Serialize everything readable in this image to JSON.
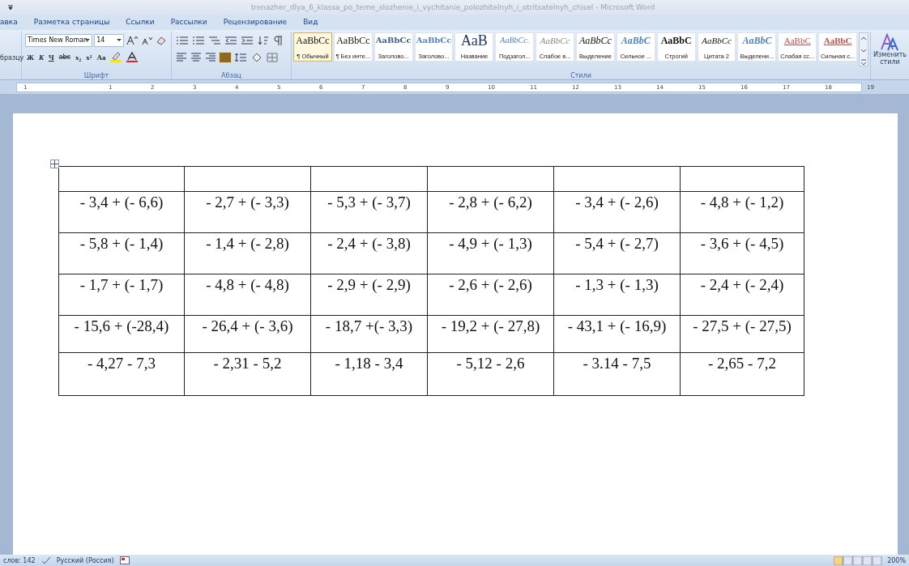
{
  "window": {
    "title": "trenazher_dlya_6_klassa_po_teme_slozhenie_i_vychitanie_polozhitelnyh_i_otritsatelnyh_chisel - Microsoft Word"
  },
  "tabs": [
    {
      "label": "авка",
      "selected": false
    },
    {
      "label": "Разметка страницы",
      "selected": false
    },
    {
      "label": "Ссылки",
      "selected": false
    },
    {
      "label": "Рассылки",
      "selected": false
    },
    {
      "label": "Рецензирование",
      "selected": false
    },
    {
      "label": "Вид",
      "selected": false
    }
  ],
  "ribbon": {
    "clipboard": {
      "label": "бразцу"
    },
    "font": {
      "name": "Times New Roman",
      "size": "14",
      "format_buttons": [
        "Ж",
        "К",
        "Ч",
        "abc",
        "x₂",
        "x²",
        "Aa"
      ],
      "group_label": "Шрифт"
    },
    "paragraph": {
      "group_label": "Абзац"
    },
    "styles": {
      "group_label": "Стили",
      "items": [
        {
          "preview": "AaBbCc",
          "label": "¶ Обычный",
          "kind": "normal",
          "selected": true
        },
        {
          "preview": "AaBbCc",
          "label": "¶ Без инте...",
          "kind": "normal",
          "selected": false
        },
        {
          "preview": "AaBbCc",
          "label": "Заголово...",
          "kind": "heading",
          "selected": false
        },
        {
          "preview": "AaBbCc",
          "label": "Заголово...",
          "kind": "heading2",
          "selected": false
        },
        {
          "preview": "AaB",
          "label": "Название",
          "kind": "title",
          "selected": false
        },
        {
          "preview": "AaBbCc.",
          "label": "Подзагол...",
          "kind": "subtitle",
          "selected": false
        },
        {
          "preview": "AaBbCc",
          "label": "Слабое в...",
          "kind": "subtle",
          "selected": false
        },
        {
          "preview": "AaBbCc",
          "label": "Выделение",
          "kind": "emphasis",
          "selected": false
        },
        {
          "preview": "AaBbC",
          "label": "Сильное ...",
          "kind": "intense",
          "selected": false
        },
        {
          "preview": "AaBbC",
          "label": "Строгий",
          "kind": "strong",
          "selected": false
        },
        {
          "preview": "AaBbCc",
          "label": "Цитата 2",
          "kind": "quote",
          "selected": false
        },
        {
          "preview": "AaBbC",
          "label": "Выделени...",
          "kind": "intense",
          "selected": false
        },
        {
          "preview": "AaBbC",
          "label": "Слабая сс...",
          "kind": "reference",
          "selected": false
        },
        {
          "preview": "AaBbC",
          "label": "Сильная с...",
          "kind": "reference-strong",
          "selected": false
        }
      ],
      "change_button": "Изменить стили"
    }
  },
  "ruler": {
    "labels": [
      "1",
      "1",
      "2",
      "3",
      "4",
      "5",
      "6",
      "7",
      "8",
      "9",
      "10",
      "11",
      "12",
      "13",
      "14",
      "15",
      "16",
      "17",
      "18",
      "19"
    ]
  },
  "table": {
    "rows": [
      [
        "",
        "",
        "",
        "",
        "",
        ""
      ],
      [
        "- 3,4 + (- 6,6)",
        "- 2,7 + (- 3,3)",
        "- 5,3 + (- 3,7)",
        "- 2,8 + (- 6,2)",
        "- 3,4 + (- 2,6)",
        "- 4,8 + (- 1,2)"
      ],
      [
        "- 5,8 + (- 1,4)",
        "- 1,4 + (- 2,8)",
        "- 2,4 + (- 3,8)",
        "- 4,9 + (- 1,3)",
        "- 5,4 + (- 2,7)",
        "- 3,6 + (- 4,5)"
      ],
      [
        "- 1,7 + (- 1,7)",
        "- 4,8 + (- 4,8)",
        "- 2,9 + (- 2,9)",
        "- 2,6 + (- 2,6)",
        "- 1,3 + (- 1,3)",
        "- 2,4 + (- 2,4)"
      ],
      [
        "- 15,6 + (-28,4)",
        "- 26,4 + (- 3,6)",
        "- 18,7 +(- 3,3)",
        "- 19,2 + (- 27,8)",
        "- 43,1 + (- 16,9)",
        "- 27,5 + (- 27,5)"
      ],
      [
        "- 4,27 - 7,3",
        "- 2,31 - 5,2",
        "- 1,18 - 3,4",
        "- 5,12 - 2,6",
        "- 3.14 - 7,5",
        "- 2,65 - 7,2"
      ]
    ]
  },
  "status_bar": {
    "words": "слов: 142",
    "language": "Русский (Россия)",
    "zoom": "200%"
  }
}
